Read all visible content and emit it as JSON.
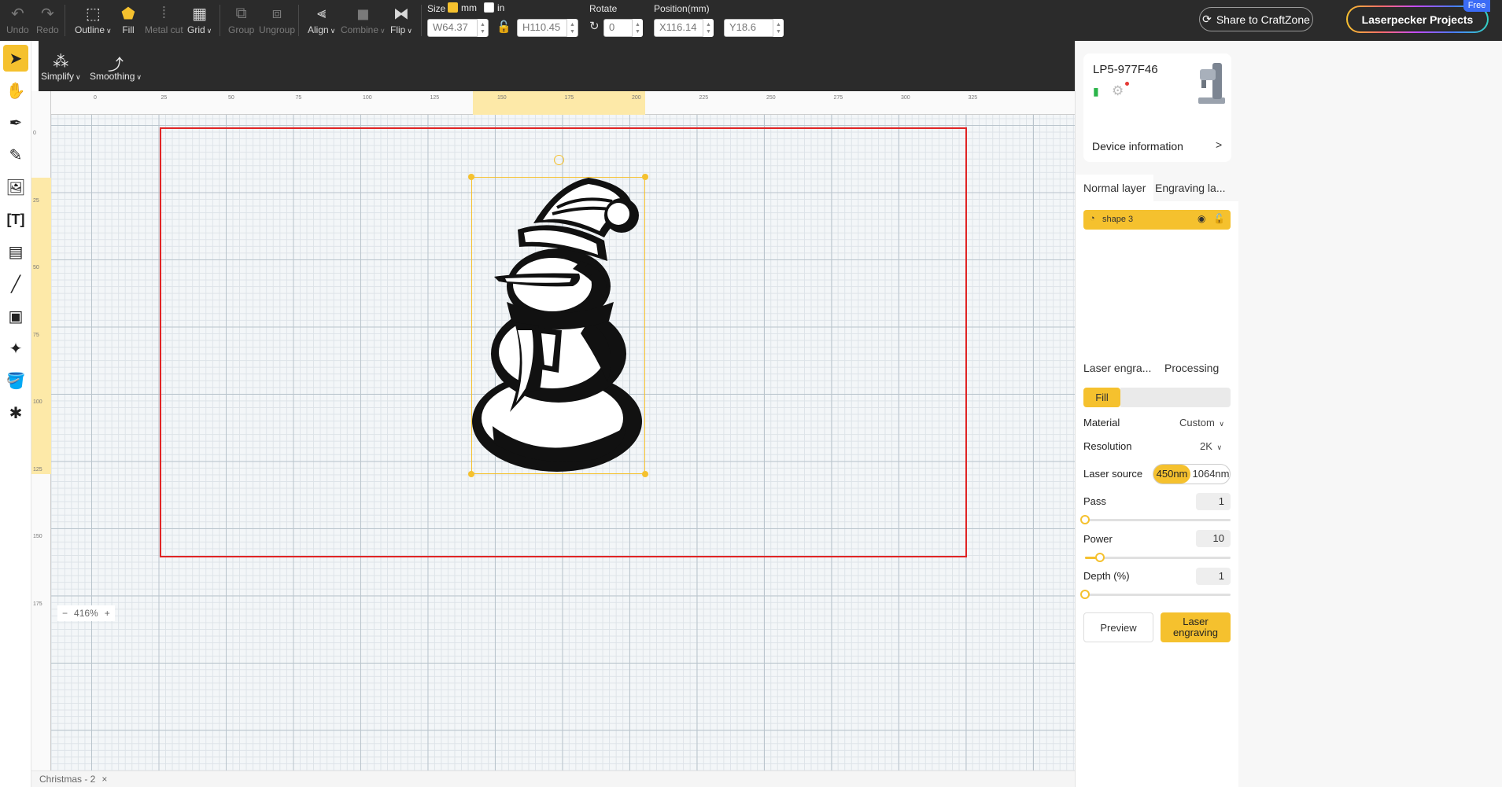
{
  "toolbar": {
    "undo": "Undo",
    "redo": "Redo",
    "outline": "Outline",
    "fill": "Fill",
    "metal_cut": "Metal cut",
    "grid": "Grid",
    "group": "Group",
    "ungroup": "Ungroup",
    "align": "Align",
    "combine": "Combine",
    "flip": "Flip",
    "size_label": "Size",
    "unit_mm": "mm",
    "unit_in": "in",
    "width_value": "W64.37",
    "height_value": "H110.45",
    "rotate_label": "Rotate",
    "rotate_value": "0",
    "position_label": "Position(mm)",
    "x_value": "X116.14",
    "y_value": "Y18.6",
    "share": "Share to CraftZone",
    "projects": "Laserpecker Projects",
    "free_badge": "Free"
  },
  "subtoolbar": {
    "simplify": "Simplify",
    "smoothing": "Smoothing"
  },
  "rulers": {
    "horizontal": [
      "25",
      "0",
      "25",
      "50",
      "75",
      "100",
      "125",
      "150",
      "175",
      "200",
      "225",
      "250",
      "275",
      "300",
      "325"
    ],
    "vertical": [
      "0",
      "25",
      "50",
      "75",
      "100",
      "125",
      "150",
      "175"
    ]
  },
  "canvas": {
    "zoom": "416%",
    "zoom_minus": "−",
    "zoom_plus": "+"
  },
  "document_tab": {
    "name": "Christmas - 2",
    "close": "×"
  },
  "device": {
    "name": "LP5-977F46",
    "info_label": "Device information",
    "arrow": ">"
  },
  "layer_tabs": [
    "Normal layer",
    "Engraving la..."
  ],
  "layers": [
    {
      "name": "shape 3"
    }
  ],
  "settings_tabs": [
    "Laser engra...",
    "Processing"
  ],
  "settings": {
    "mode": "Fill",
    "material_label": "Material",
    "material_value": "Custom",
    "resolution_label": "Resolution",
    "resolution_value": "2K",
    "laser_source_label": "Laser source",
    "laser_source_options": [
      "450nm",
      "1064nm"
    ],
    "laser_source_selected": "450nm",
    "pass_label": "Pass",
    "pass_value": "1",
    "pass_fraction": 0.0,
    "power_label": "Power",
    "power_value": "10",
    "power_fraction": 0.1,
    "depth_label": "Depth (%)",
    "depth_value": "1",
    "depth_fraction": 0.0,
    "preview": "Preview",
    "engrave_line1": "Laser",
    "engrave_line2": "engraving"
  },
  "colors": {
    "accent": "#f5c12e",
    "work_area_border": "#e02424",
    "toolbar_bg": "#2b2b2b"
  }
}
